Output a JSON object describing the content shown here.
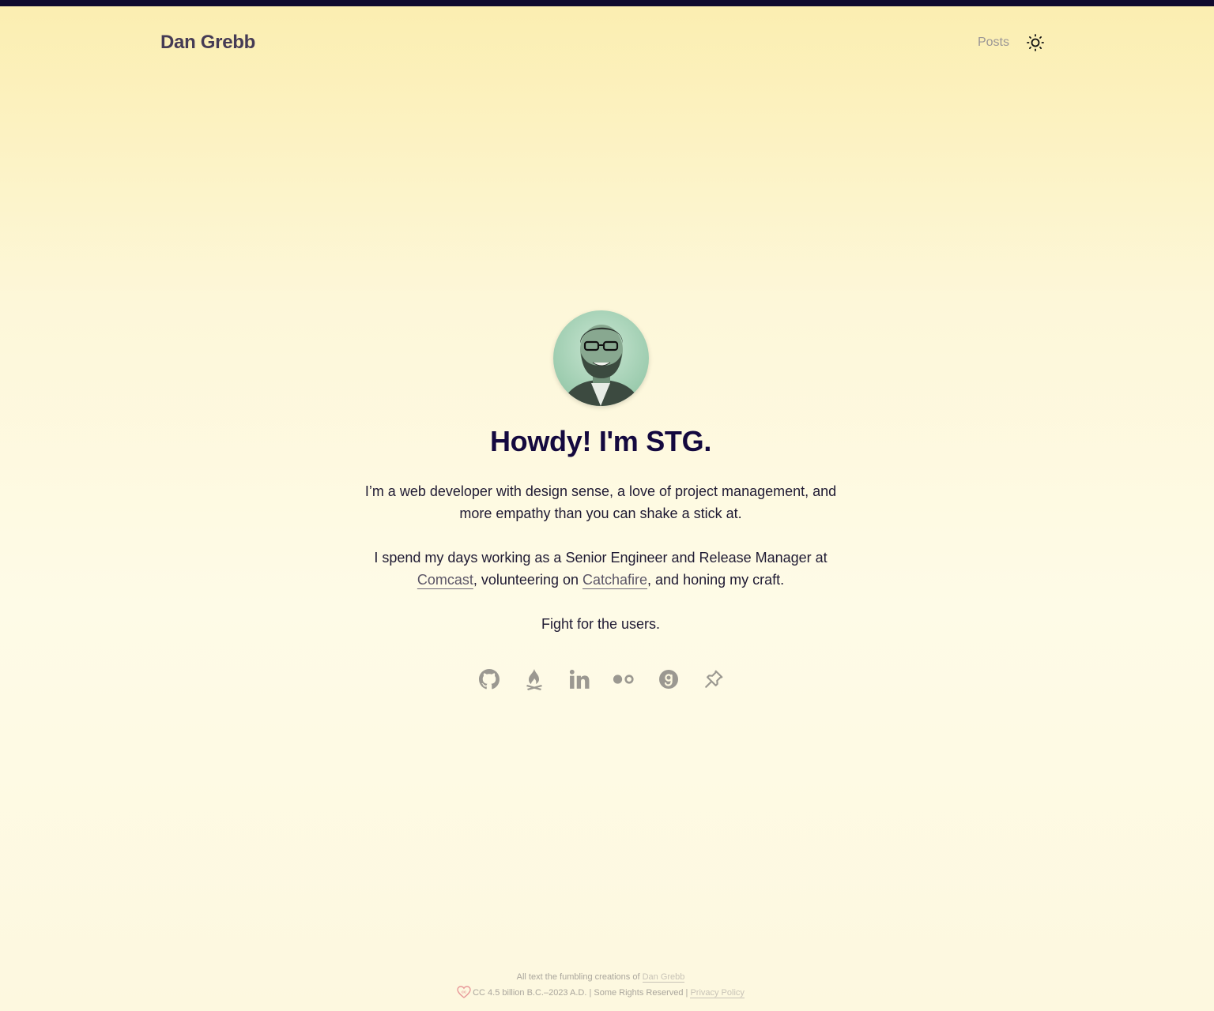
{
  "header": {
    "site_title": "Dan Grebb",
    "nav": {
      "posts_label": "Posts"
    },
    "theme_icon": "sun-icon"
  },
  "hero": {
    "heading": "Howdy! I'm STG.",
    "intro": "I’m a web developer with design sense, a love of project management, and more empathy than you can shake a stick at.",
    "work": {
      "prefix": "I spend my days working as a Senior Engineer and Release Manager at ",
      "link1": "Comcast",
      "middle": ", volunteering on ",
      "link2": "Catchafire",
      "suffix": ", and honing my craft."
    },
    "tagline": "Fight for the users."
  },
  "socials": [
    {
      "icon": "github-icon"
    },
    {
      "icon": "campfire-icon"
    },
    {
      "icon": "linkedin-icon"
    },
    {
      "icon": "flickr-icon"
    },
    {
      "icon": "goodreads-icon"
    },
    {
      "icon": "pin-icon"
    }
  ],
  "footer": {
    "line1_prefix": "All text the fumbling creations of ",
    "author_link": "Dan Grebb",
    "line2": "CC 4.5 billion B.C.–2023 A.D. | Some Rights Reserved | ",
    "privacy_link": "Privacy Policy",
    "cc_icon": "creative-commons-heart-icon"
  },
  "colors": {
    "top_bar": "#0f0a2e",
    "heading": "#14093f",
    "icon_gray": "#9b9891"
  }
}
